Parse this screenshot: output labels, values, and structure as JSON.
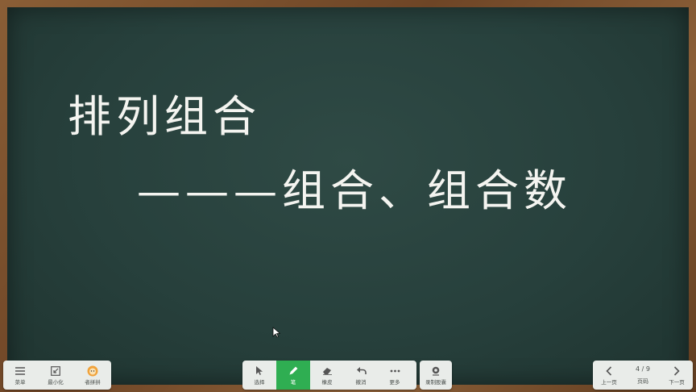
{
  "board": {
    "title": "排列组合",
    "subtitle": "———组合、组合数"
  },
  "left_toolbar": {
    "menu_label": "菜单",
    "minimize_label": "最小化",
    "assistant_label": "者拼拼"
  },
  "center_toolbar": {
    "select_label": "选择",
    "pen_label": "笔",
    "eraser_label": "橡皮",
    "undo_label": "撤消",
    "more_label": "更多"
  },
  "record_toolbar": {
    "record_label": "录制股囊"
  },
  "page_toolbar": {
    "prev_label": "上一页",
    "page_label": "页码",
    "next_label": "下一页",
    "current_page": "4 / 9"
  },
  "colors": {
    "board": "#27403c",
    "frame": "#7a5030",
    "active_tool": "#2fae52",
    "chalk": "#f4f4f0"
  }
}
